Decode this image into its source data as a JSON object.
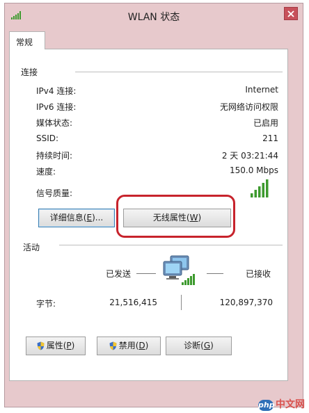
{
  "window": {
    "title": "WLAN 状态",
    "close_label": "✕"
  },
  "tabs": [
    "常规"
  ],
  "connection": {
    "label": "连接",
    "rows": [
      {
        "label": "IPv4 连接:",
        "value": "Internet"
      },
      {
        "label": "IPv6 连接:",
        "value": "无网络访问权限"
      },
      {
        "label": "媒体状态:",
        "value": "已启用"
      },
      {
        "label": "SSID:",
        "value": "211"
      },
      {
        "label": "持续时间:",
        "value": "2 天 03:21:44"
      },
      {
        "label": "速度:",
        "value": "150.0 Mbps"
      }
    ],
    "signal": {
      "label": "信号质量:",
      "bars_filled": 5,
      "bars_total": 5
    }
  },
  "buttons": {
    "details": {
      "text": "详细信息(",
      "key": "E",
      "suffix": ")..."
    },
    "wireless": {
      "text": "无线属性(",
      "key": "W",
      "suffix": ")"
    },
    "properties": {
      "text": "属性(",
      "key": "P",
      "suffix": ")"
    },
    "disable": {
      "text": "禁用(",
      "key": "D",
      "suffix": ")"
    },
    "diagnose": {
      "text": "诊断(",
      "key": "G",
      "suffix": ")"
    }
  },
  "activity": {
    "label": "活动",
    "sent_label": "已发送",
    "received_label": "已接收",
    "bytes_label": "字节:",
    "bytes_sent": "21,516,415",
    "bytes_received": "120,897,370"
  },
  "watermark": {
    "logo": "php",
    "text": "中文网"
  },
  "colors": {
    "frame": "#e7c9cc",
    "highlight": "#c7232c",
    "signal": "#3d9a2e",
    "close": "#c7505a"
  }
}
